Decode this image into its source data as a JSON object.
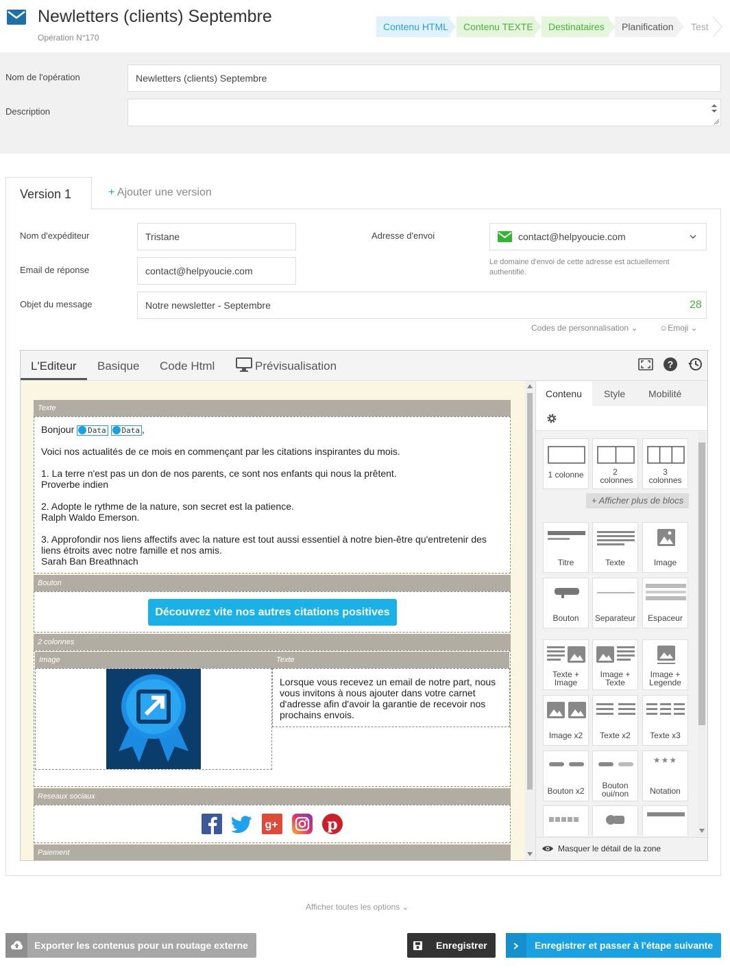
{
  "header": {
    "title": "Newletters (clients) Septembre",
    "subtitle": "Opération N°170"
  },
  "steps": [
    {
      "label": "Contenu HTML",
      "state": "current",
      "color": "#dff2fb",
      "text": "#2a9fd6"
    },
    {
      "label": "Contenu TEXTE",
      "state": "done",
      "color": "#e4f7dc",
      "text": "#4cae3a"
    },
    {
      "label": "Destinataires",
      "state": "done",
      "color": "#e4f7dc",
      "text": "#4cae3a"
    },
    {
      "label": "Planification",
      "state": "todo",
      "color": "#f1f1f1",
      "text": "#555555"
    },
    {
      "label": "Test",
      "state": "todo",
      "color": "#ffffff",
      "text": "#aaaaaa"
    }
  ],
  "form": {
    "name_label": "Nom de l'opération",
    "name_value": "Newletters (clients) Septembre",
    "desc_label": "Description",
    "desc_value": ""
  },
  "versions": {
    "active": "Version 1",
    "add_label": "Ajouter une version"
  },
  "sender": {
    "name_label": "Nom d'expéditeur",
    "name_value": "Tristane",
    "reply_label": "Email de réponse",
    "reply_value": "contact@helpyoucie.com",
    "subject_label": "Objet du message",
    "subject_value": "Notre newsletter - Septembre",
    "subject_count": "28",
    "address_label": "Adresse d'envoi",
    "address_value": "contact@helpyoucie.com",
    "address_note": "Le domaine d'envoi de cette adresse est actuellement authentifié.",
    "perso_codes": "Codes de personnalisation",
    "emoji": "Emoji"
  },
  "editor": {
    "tabs": [
      "L'Editeur",
      "Basique",
      "Code Html",
      "Prévisualisation"
    ],
    "blocks": {
      "text_head": "Texte",
      "greeting": "Bonjour",
      "badge": "Data",
      "intro": "Voici nos actualités de ce mois en commençant par les citations inspirantes du mois.",
      "q1": "1. La terre n'est pas un don de nos parents, ce sont nos enfants qui nous la prêtent.",
      "q1_author": "Proverbe indien",
      "q2": "2. Adopte le rythme de la nature, son secret est la patience.",
      "q2_author": "Ralph Waldo Emerson.",
      "q3a": "3. Approfondir nos liens affectifs avec la nature est tout aussi essentiel à notre bien-être qu'entretenir des",
      "q3b": "liens étroits avec notre famille et nos amis.",
      "q3_author": "Sarah Ban Breathnach",
      "button_head": "Bouton",
      "cta": "Découvrez vite nos autres citations positives",
      "twocol_head": "2 colonnes",
      "image_head": "Image",
      "text2_head": "Texte",
      "col_text": [
        "Lorsque vous recevez un email de notre part, nous",
        "vous invitons à nous ajouter dans votre carnet",
        "d'adresse afin d'avoir la garantie de recevoir nos",
        "prochains envois."
      ],
      "social_head": "Reseaux sociaux",
      "pay_head": "Paiement"
    },
    "panel": {
      "tabs": [
        "Contenu",
        "Style",
        "Mobilité"
      ],
      "layouts": [
        "1 colonne",
        "2 colonnes",
        "3 colonnes"
      ],
      "more_blocks": "+ Afficher plus de blocs",
      "tiles": [
        "Titre",
        "Texte",
        "Image",
        "Bouton",
        "Separateur",
        "Espaceur",
        "Texte + Image",
        "Image + Texte",
        "Image + Legende",
        "Image x2",
        "Texte x2",
        "Texte x3",
        "Bouton x2",
        "Bouton oui/non",
        "Notation"
      ],
      "hide_detail": "Masquer le détail de la zone"
    }
  },
  "footer": {
    "show_options": "Afficher toutes les options",
    "export": "Exporter les contenus pour un routage externe",
    "save": "Enregistrer",
    "save_next": "Enregistrer et passer à l'étape suivante"
  },
  "colors": {
    "accent": "#1aa1e1",
    "cta": "#1ab1e8",
    "green": "#4cae3a",
    "dark": "#444444"
  }
}
